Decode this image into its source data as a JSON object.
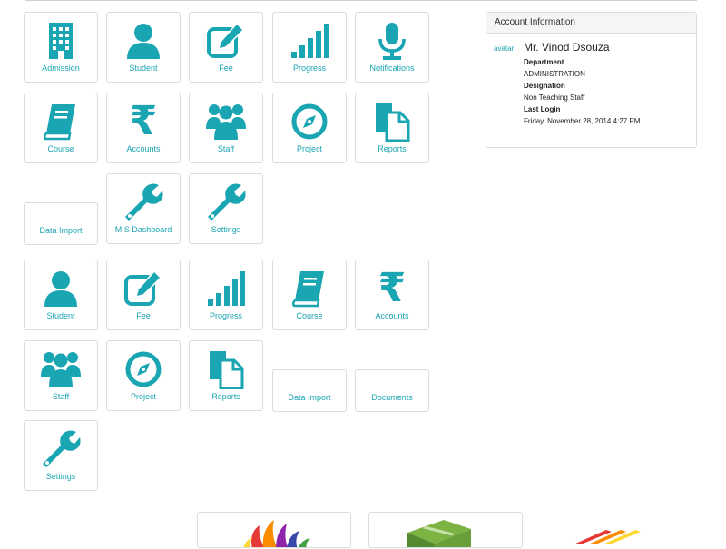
{
  "section1": [
    {
      "label": "Admission",
      "icon": "building-icon"
    },
    {
      "label": "Student",
      "icon": "user-icon"
    },
    {
      "label": "Fee",
      "icon": "edit-icon"
    },
    {
      "label": "Progress",
      "icon": "signal-bars-icon"
    },
    {
      "label": "Notifications",
      "icon": "microphone-icon"
    },
    {
      "label": "Course",
      "icon": "book-icon"
    },
    {
      "label": "Accounts",
      "icon": "rupee-icon"
    },
    {
      "label": "Staff",
      "icon": "users-group-icon"
    },
    {
      "label": "Project",
      "icon": "compass-icon"
    },
    {
      "label": "Reports",
      "icon": "documents-icon"
    },
    {
      "label": "Data Import",
      "icon": ""
    },
    {
      "label": "MIS Dashboard",
      "icon": "wrench-icon"
    },
    {
      "label": "Settings",
      "icon": "wrench-icon"
    }
  ],
  "section2": [
    {
      "label": "Student",
      "icon": "user-icon"
    },
    {
      "label": "Fee",
      "icon": "edit-icon"
    },
    {
      "label": "Progress",
      "icon": "signal-bars-icon"
    },
    {
      "label": "Course",
      "icon": "book-icon"
    },
    {
      "label": "Accounts",
      "icon": "rupee-icon"
    },
    {
      "label": "Staff",
      "icon": "users-group-icon"
    },
    {
      "label": "Project",
      "icon": "compass-icon"
    },
    {
      "label": "Reports",
      "icon": "documents-icon"
    },
    {
      "label": "Data Import",
      "icon": ""
    },
    {
      "label": "Documents",
      "icon": ""
    },
    {
      "label": "Settings",
      "icon": "wrench-icon"
    }
  ],
  "account": {
    "header": "Account Information",
    "avatar_alt": "avatar",
    "name": "Mr. Vinod Dsouza",
    "department_label": "Department",
    "department": "ADMINISTRATION",
    "designation_label": "Designation",
    "designation": "Non Teaching Staff",
    "last_login_label": "Last Login",
    "last_login": "Friday, November 28, 2014 4:27 PM"
  },
  "colors": {
    "accent": "#1aa5b3",
    "border": "#dcdcdc"
  }
}
